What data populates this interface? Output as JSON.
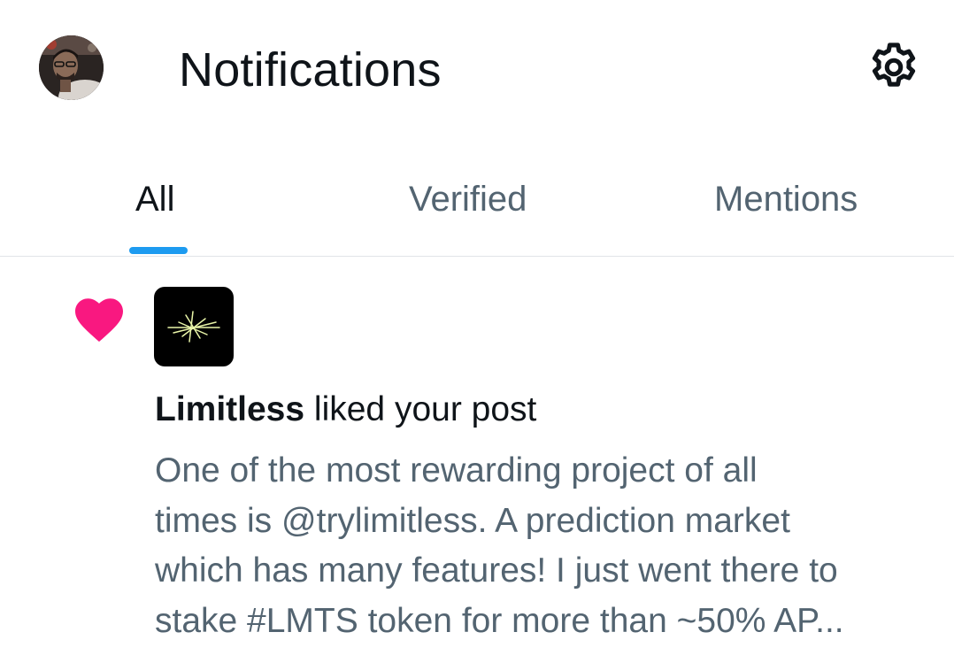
{
  "header": {
    "title": "Notifications",
    "avatar_icon": "profile-photo",
    "settings_icon": "gear-icon"
  },
  "tabs": [
    {
      "label": "All",
      "active": true
    },
    {
      "label": "Verified",
      "active": false
    },
    {
      "label": "Mentions",
      "active": false
    }
  ],
  "colors": {
    "accent": "#1d9bf0",
    "like": "#f91880",
    "text_primary": "#0f1419",
    "text_secondary": "#536471"
  },
  "notification": {
    "type_icon": "heart-icon",
    "actor_avatar_icon": "limitless-logo",
    "actor": "Limitless",
    "action": " liked your post",
    "post_lines": [
      "One of the most rewarding project of all",
      "times is @trylimitless. A prediction market",
      "which has many features! I just went there to",
      "stake #LMTS token for more than ~50% AP..."
    ]
  }
}
